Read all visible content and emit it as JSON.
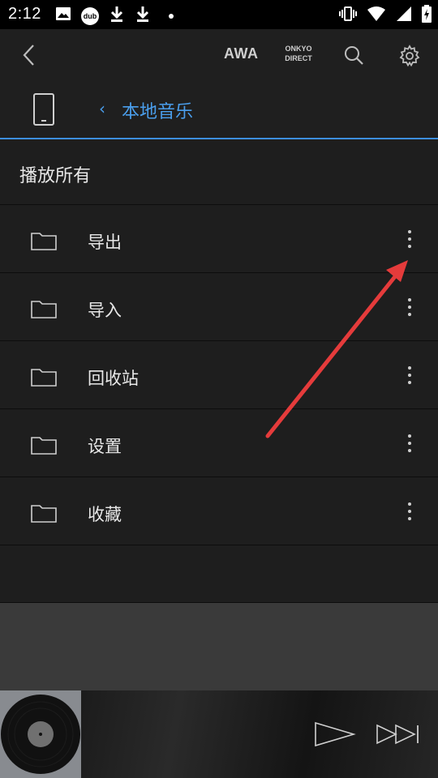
{
  "status_bar": {
    "time": "2:12",
    "left_icons": [
      "image-icon",
      "dub-icon",
      "download-icon",
      "download-icon",
      "dot-icon"
    ],
    "dub_text": "dub",
    "right_icons": [
      "vibrate-icon",
      "wifi-icon",
      "signal-icon",
      "battery-charging-icon"
    ]
  },
  "header": {
    "awa_label": "AWA",
    "onkyo_line1": "ONKYO",
    "onkyo_line2": "DIRECT"
  },
  "breadcrumb": {
    "back_glyph": "‹",
    "title": "本地音乐"
  },
  "play_all": {
    "label": "播放所有"
  },
  "folders": [
    {
      "label": "导出"
    },
    {
      "label": "导入"
    },
    {
      "label": "回收站"
    },
    {
      "label": "设置"
    },
    {
      "label": "收藏"
    }
  ],
  "colors": {
    "accent": "#4a9eec",
    "background": "#1e1e1e",
    "annotation": "#e53b3b"
  }
}
